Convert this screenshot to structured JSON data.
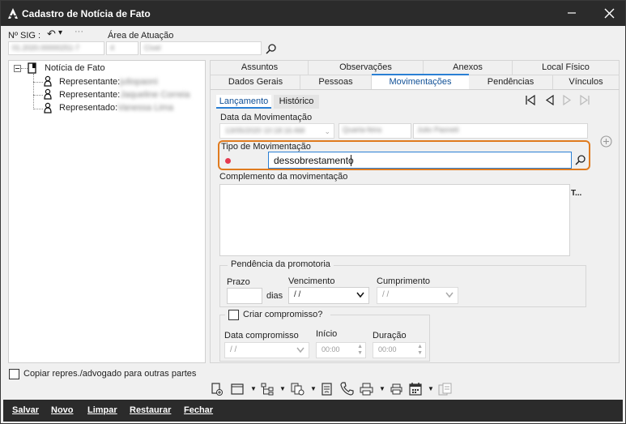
{
  "window": {
    "title": "Cadastro de Notícia de Fato"
  },
  "header": {
    "sig_label": "Nº SIG :",
    "sig_value": "01.2020.00000251-7",
    "area_label": "Área de Atuação",
    "area_code": "4",
    "area_name": "Cível"
  },
  "tree": {
    "root": "Notícia de Fato",
    "items": [
      {
        "label": "Representante:",
        "value": "juliopaoni"
      },
      {
        "label": "Representante:",
        "value": "Jaqueline Correia"
      },
      {
        "label": "Representado:",
        "value": "Vanessa Lima"
      }
    ]
  },
  "copy_checkbox": {
    "label": "Copiar repres./advogado para outras partes",
    "checked": false
  },
  "tabs_row1": [
    "Assuntos",
    "Observações",
    "Anexos",
    "Local Físico"
  ],
  "tabs_row2": [
    "Dados Gerais",
    "Pessoas",
    "Movimentações",
    "Pendências",
    "Vínculos"
  ],
  "active_tab": "Movimentações",
  "subtabs": [
    "Lançamento",
    "Histórico"
  ],
  "movement": {
    "data_label": "Data da Movimentação",
    "data_value": "13/05/2020 10:18:16 AM",
    "weekday": "Quarta-feira",
    "user": "Julio Paoneti",
    "tipo_label": "Tipo de Movimentação",
    "tipo_value": "dessobrestamento",
    "complemento_label": "Complemento da movimentação",
    "complemento_marker": "T..."
  },
  "pendencia": {
    "group_label": "Pendência da promotoria",
    "prazo_label": "Prazo",
    "dias_label": "dias",
    "vencimento_label": "Vencimento",
    "vencimento_value": " / /",
    "cumprimento_label": "Cumprimento",
    "cumprimento_value": " / /"
  },
  "compromisso": {
    "checkbox_label": "Criar compromisso?",
    "data_label": "Data compromisso",
    "data_value": " / /",
    "inicio_label": "Início",
    "inicio_value": "00:00",
    "duracao_label": "Duração",
    "duracao_value": "00:00"
  },
  "footer": {
    "salvar": "Salvar",
    "novo": "Novo",
    "limpar": "Limpar",
    "restaurar": "Restaurar",
    "fechar": "Fechar"
  },
  "colors": {
    "accent": "#2a7fd4",
    "highlight": "#e07b1f",
    "required": "#e53950",
    "titlebar": "#2b2b2b"
  }
}
